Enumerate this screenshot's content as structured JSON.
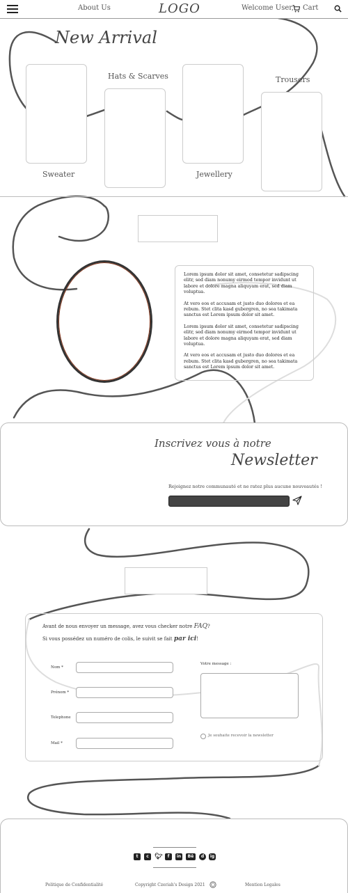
{
  "header": {
    "about": "About Us",
    "logo": "LOGO",
    "welcome": "Welcome User,",
    "cart": "Cart"
  },
  "arrivals": {
    "title": "New Arrival",
    "categories": [
      "Sweater",
      "Hats & Scarves",
      "Jewellery",
      "Trousers"
    ]
  },
  "article": {
    "paragraphs": [
      "Lorem ipsum dolor sit amet, consetetur sadipscing elitr, sed diam nonumy eirmod tempor invidunt ut labore et dolore magna aliquyam erat, sed diam voluptua.",
      "At vero eos et accusam et justo duo dolores et ea rebum. Stet clita kasd gubergren, no sea takimata sanctus est Lorem ipsum dolor sit amet.",
      "Lorem ipsum dolor sit amet, consetetur sadipscing elitr, sed diam nonumy eirmod tempor invidunt ut labore et dolore magna aliquyam erat, sed diam voluptua.",
      "At vero eos et accusam et justo duo dolores et ea rebum. Stet clita kasd gubergren, no sea takimata sanctus est Lorem ipsum dolor sit amet."
    ]
  },
  "newsletter": {
    "title_line1": "Inscrivez vous à notre",
    "title_line2": "Newsletter",
    "subtitle": "Rejoignez notre communauté et ne ratez plus aucune nouveautés !"
  },
  "contact": {
    "line1_prefix": "Avant de nous envoyer un message, avez vous checker notre",
    "line1_link": "FAQ",
    "line1_suffix": "?",
    "line2_prefix": "Si vous possédez un numéro de colis, le suivit se fait",
    "line2_link": "par ici",
    "line2_suffix": "!",
    "fields": [
      "Nom *",
      "Prénom *",
      "Telephone",
      "Mail *"
    ],
    "message_label": "Votre message :",
    "newsletter_opt": "Je souhaite recevoir la newsletter"
  },
  "footer": {
    "social": [
      "t",
      "c",
      "y",
      "f",
      "in",
      "Bē",
      "d",
      "ig"
    ],
    "privacy": "Politique de Confidentialité",
    "copyright": "Copyright Czeriah's Design 2021",
    "legal": "Mention Legales"
  },
  "colors": {
    "swirl": "#555555",
    "oval_accent": "#8a3a1e",
    "input_dark": "#444444"
  }
}
